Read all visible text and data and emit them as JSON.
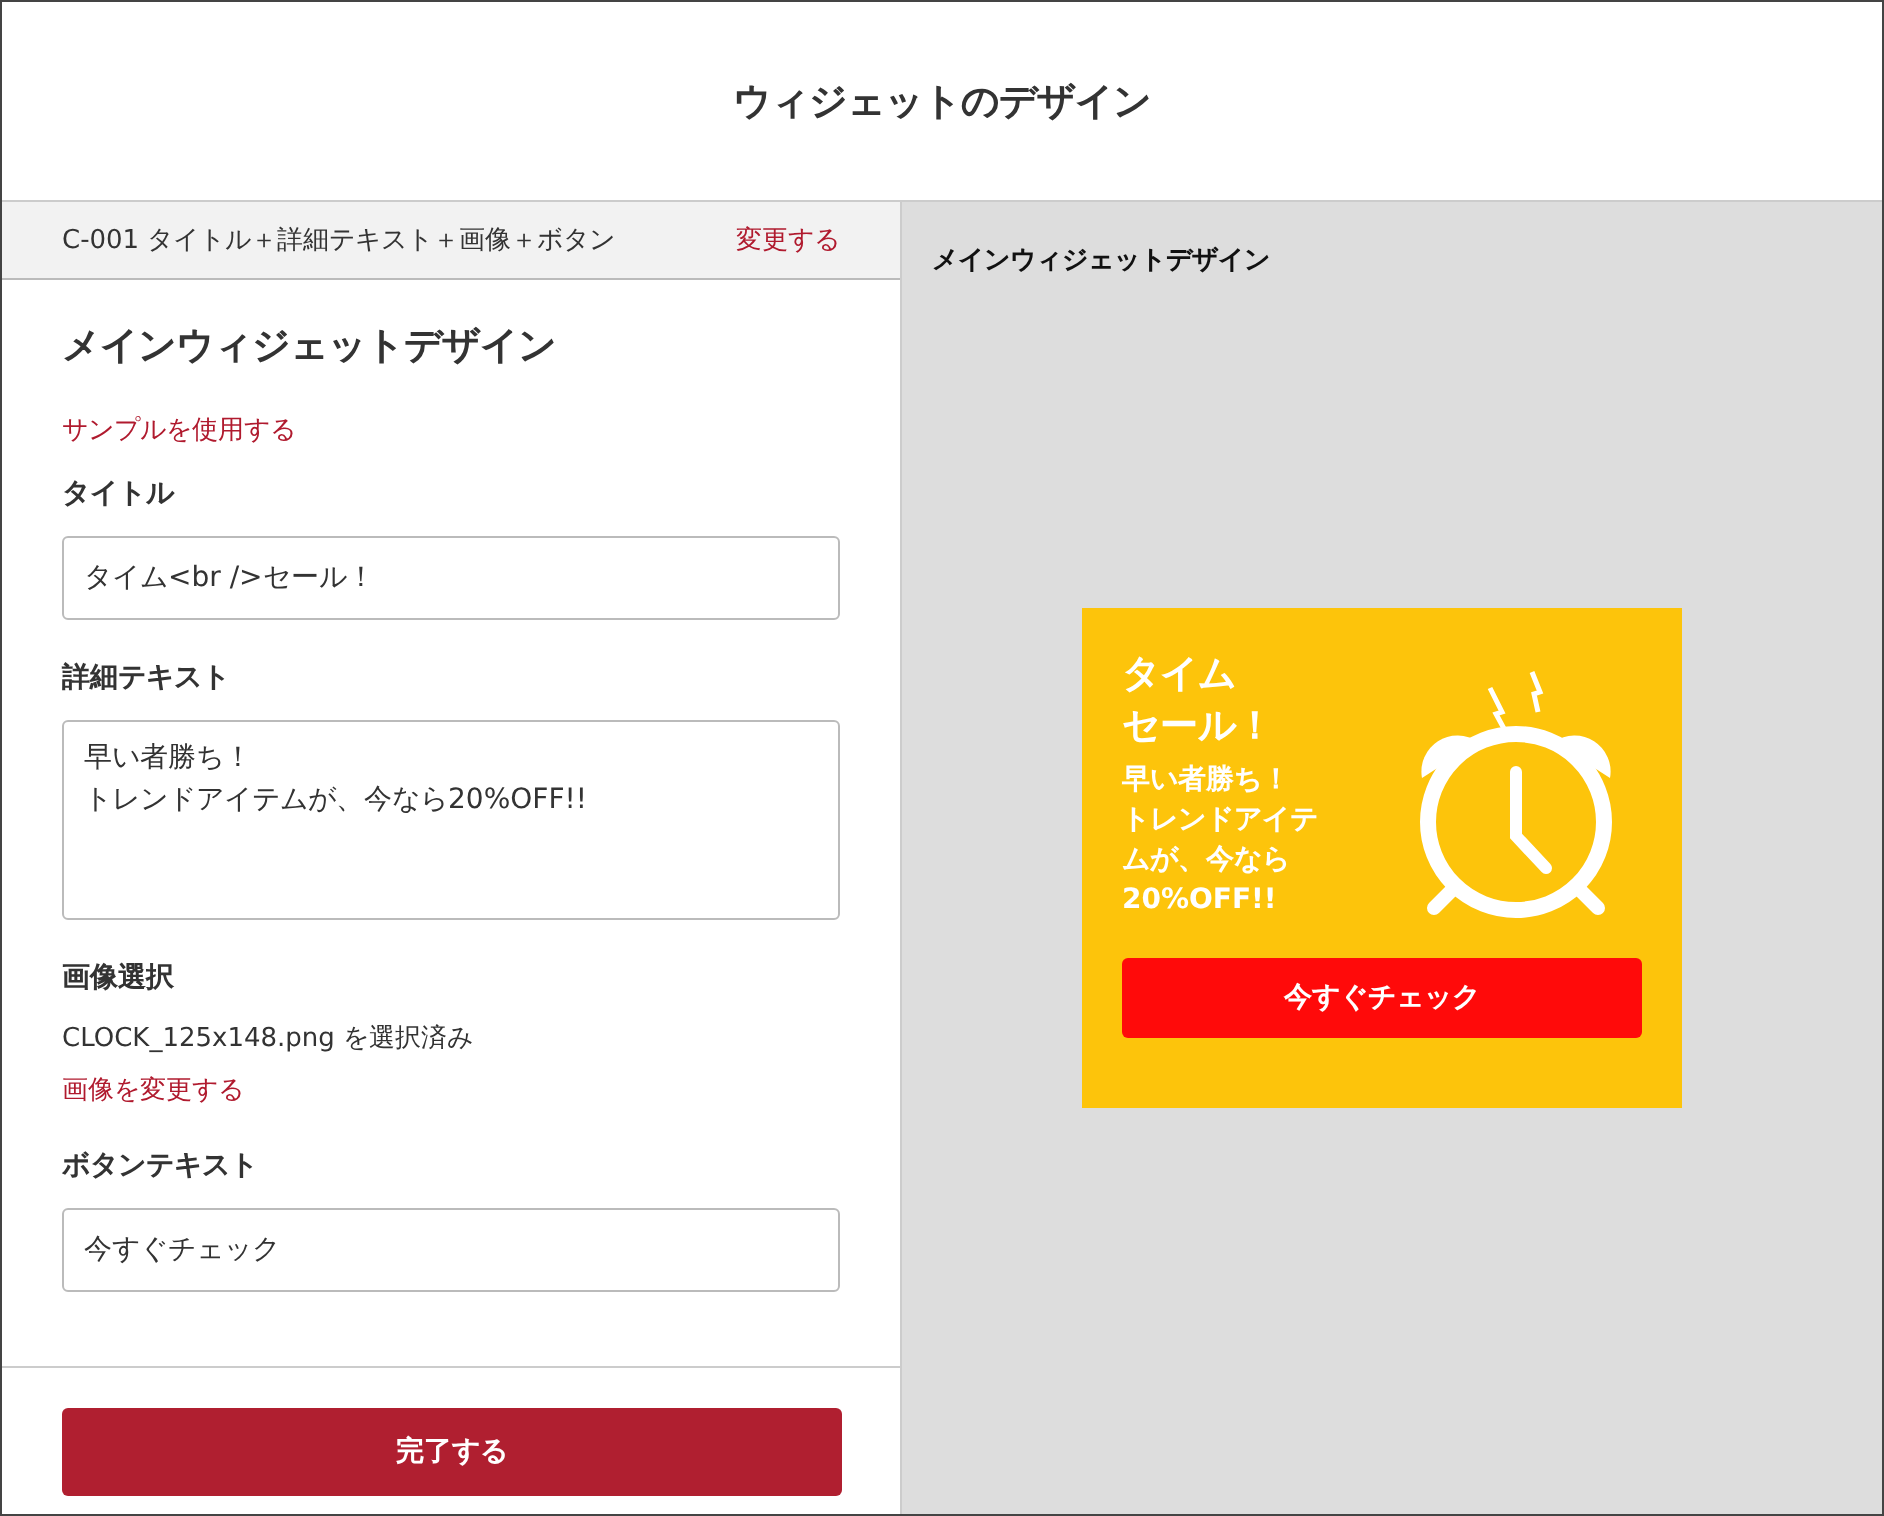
{
  "header": {
    "title": "ウィジェットのデザイン"
  },
  "template_bar": {
    "label": "C-001 タイトル＋詳細テキスト＋画像＋ボタン",
    "link": "変更する"
  },
  "form": {
    "heading": "メインウィジェットデザイン",
    "sample_link": "サンプルを使用する",
    "fields": [
      {
        "kind": "input",
        "label": "タイトル",
        "value": "タイム<br />セール！"
      },
      {
        "kind": "textarea",
        "label": "詳細テキスト",
        "lines": [
          "早い者勝ち！",
          "トレンドアイテムが、今なら20%OFF!!"
        ]
      },
      {
        "kind": "image",
        "label": "画像選択",
        "value": "CLOCK_125x148.png を選択済み",
        "link": "画像を変更する"
      },
      {
        "kind": "input",
        "label": "ボタンテキスト",
        "value": "今すぐチェック"
      }
    ]
  },
  "footer": {
    "button": "完了する"
  },
  "preview": {
    "label": "メインウィジェットデザイン",
    "title_lines": [
      "タイム",
      "セール！"
    ],
    "detail_lines": [
      "早い者勝ち！",
      "トレンドアイテムが、今なら20%OFF!!"
    ],
    "button": "今すぐチェック"
  }
}
